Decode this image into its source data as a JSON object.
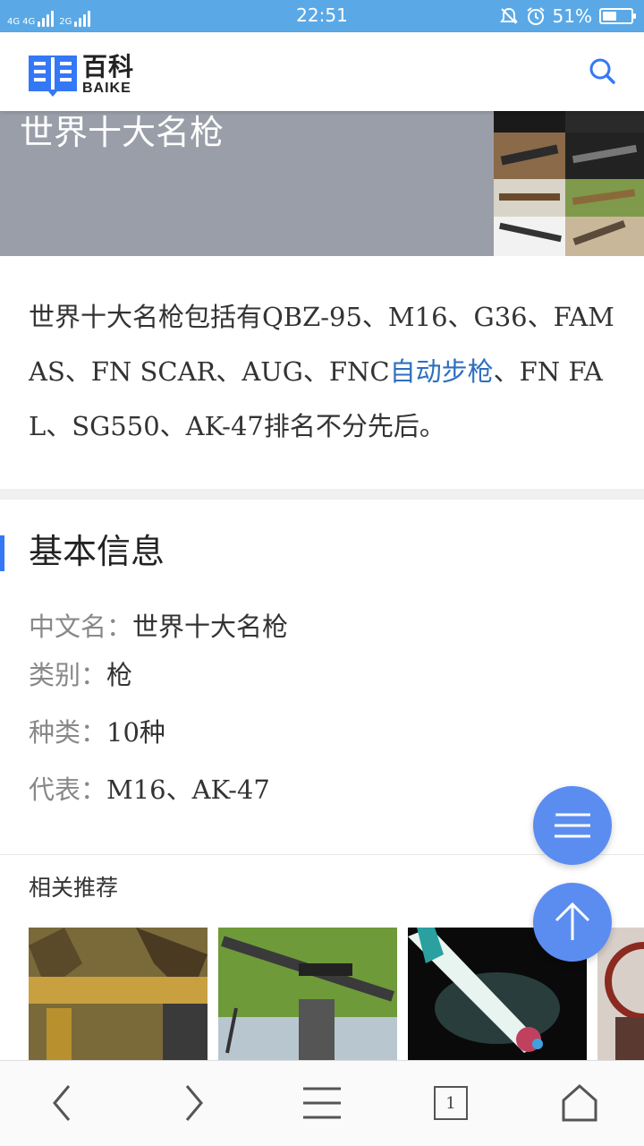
{
  "status_bar": {
    "signal_1": "4G",
    "signal_2": "4G",
    "signal_3": "2G",
    "time": "22:51",
    "battery_pct": "51%",
    "battery_level": 0.51
  },
  "header": {
    "logo_cn": "百科",
    "logo_en": "BAIKE"
  },
  "hero": {
    "title": "世界十大名枪"
  },
  "summary": {
    "text_before": "世界十大名枪包括有QBZ-95、M16、G36、FAMAS、FN SCAR、AUG、FNC",
    "link_text": "自动步枪",
    "text_after": "、FN FAL、SG550、AK-47排名不分先后。"
  },
  "basic_info": {
    "title": "基本信息",
    "rows": [
      {
        "label": "中文名：",
        "value": "世界十大名枪"
      },
      {
        "label": "类别：",
        "value": "枪"
      },
      {
        "label": "种类：",
        "value": "10种"
      },
      {
        "label": "代表：",
        "value": "M16、AK-47"
      }
    ]
  },
  "related": {
    "title": "相关推荐"
  },
  "colors": {
    "status_bar": "#5aa9e6",
    "accent": "#3478f6",
    "link": "#2f6fbe",
    "fab": "#5b8df0"
  },
  "bottom_nav": {
    "tab_count": "1"
  }
}
